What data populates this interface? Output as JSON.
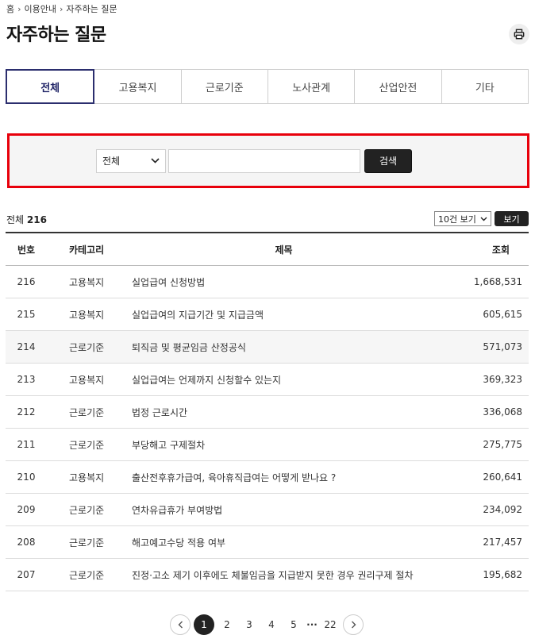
{
  "breadcrumb": {
    "home": "홈",
    "level1": "이용안내",
    "level2": "자주하는 질문"
  },
  "page": {
    "title": "자주하는 질문"
  },
  "tabs": [
    {
      "label": "전체",
      "active": true
    },
    {
      "label": "고용복지"
    },
    {
      "label": "근로기준"
    },
    {
      "label": "노사관계"
    },
    {
      "label": "산업안전"
    },
    {
      "label": "기타"
    }
  ],
  "search": {
    "select_value": "전체",
    "input_value": "",
    "button_label": "검색"
  },
  "list": {
    "total_label": "전체",
    "total_count": "216",
    "per_page_value": "10건 보기",
    "view_button": "보기"
  },
  "table": {
    "headers": {
      "no": "번호",
      "category": "카테고리",
      "title": "제목",
      "views": "조회"
    },
    "rows": [
      {
        "no": "216",
        "category": "고용복지",
        "title": "실업급여 신청방법",
        "views": "1,668,531"
      },
      {
        "no": "215",
        "category": "고용복지",
        "title": "실업급여의 지급기간 및 지급금액",
        "views": "605,615"
      },
      {
        "no": "214",
        "category": "근로기준",
        "title": "퇴직금 및 평균임금 산정공식",
        "views": "571,073"
      },
      {
        "no": "213",
        "category": "고용복지",
        "title": "실업급여는 언제까지 신청할수 있는지",
        "views": "369,323"
      },
      {
        "no": "212",
        "category": "근로기준",
        "title": "법정 근로시간",
        "views": "336,068"
      },
      {
        "no": "211",
        "category": "근로기준",
        "title": "부당해고 구제절차",
        "views": "275,775"
      },
      {
        "no": "210",
        "category": "고용복지",
        "title": "출산전후휴가급여, 육아휴직급여는 어떻게 받나요 ?",
        "views": "260,641"
      },
      {
        "no": "209",
        "category": "근로기준",
        "title": "연차유급휴가 부여방법",
        "views": "234,092"
      },
      {
        "no": "208",
        "category": "근로기준",
        "title": "해고예고수당 적용 여부",
        "views": "217,457"
      },
      {
        "no": "207",
        "category": "근로기준",
        "title": "진정·고소 제기 이후에도 체불임금을 지급받지 못한 경우 권리구제 절차",
        "views": "195,682"
      }
    ]
  },
  "pagination": {
    "pages": [
      "1",
      "2",
      "3",
      "4",
      "5"
    ],
    "ellipsis": "···",
    "last": "22",
    "current": "1"
  }
}
